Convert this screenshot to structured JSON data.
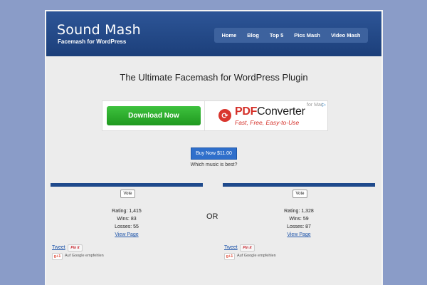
{
  "header": {
    "title": "Sound Mash",
    "tagline": "Facemash for WordPress",
    "nav": [
      "Home",
      "Blog",
      "Top 5",
      "Pics Mash",
      "Video Mash"
    ]
  },
  "main": {
    "headline": "The Ultimate Facemash for WordPress Plugin",
    "ad": {
      "download_label": "Download Now",
      "brand_pdf": "PDF",
      "brand_rest": "Converter",
      "slogan": "Fast, Free, Easy-to-Use",
      "for_mac": "for Mac",
      "ad_choice": "▷"
    },
    "buy_label": "Buy Now $11.00",
    "question": "Which music is best?",
    "or_label": "OR"
  },
  "left": {
    "vote_label": "Vote",
    "rating": "Rating: 1,415",
    "wins": "Wins: 83",
    "losses": "Losses: 55",
    "view_page": "View Page",
    "tweet": "Tweet",
    "pinit": "Pin it",
    "gplus": "g+1",
    "google_text": "Auf Google empfehlen"
  },
  "right": {
    "vote_label": "Vote",
    "rating": "Rating: 1,328",
    "wins": "Wins: 59",
    "losses": "Losses: 87",
    "view_page": "View Page",
    "tweet": "Tweet",
    "pinit": "Pin it",
    "gplus": "g+1",
    "google_text": "Auf Google empfehlen"
  },
  "colors": {
    "background": "#8a9cc8",
    "header": "#2d5597",
    "accent_bar": "#1f4a8c",
    "buy_button": "#2f6fcb",
    "download_button": "#2fb02f"
  }
}
